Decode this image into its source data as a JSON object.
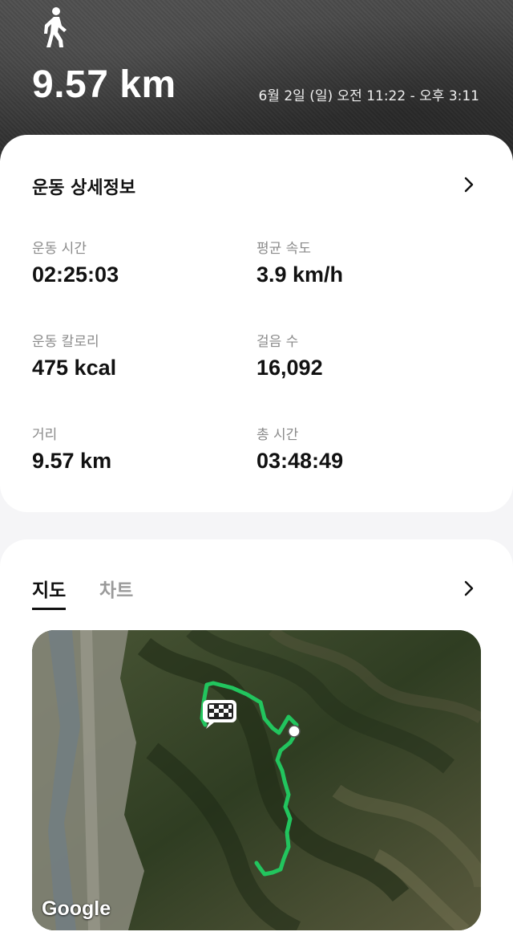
{
  "header": {
    "activity_icon": "walking-person-icon",
    "distance": "9.57 km",
    "date_range": "6월 2일 (일) 오전 11:22 - 오후 3:11"
  },
  "details": {
    "title": "운동 상세정보",
    "chevron_icon": "chevron-right-icon",
    "stats": [
      {
        "label": "운동 시간",
        "value": "02:25:03"
      },
      {
        "label": "평균 속도",
        "value": "3.9 km/h"
      },
      {
        "label": "운동 칼로리",
        "value": "475 kcal"
      },
      {
        "label": "걸음 수",
        "value": "16,092"
      },
      {
        "label": "거리",
        "value": "9.57 km"
      },
      {
        "label": "총 시간",
        "value": "03:48:49"
      }
    ]
  },
  "map_section": {
    "tabs": [
      {
        "label": "지도",
        "active": true
      },
      {
        "label": "차트",
        "active": false
      }
    ],
    "chevron_icon": "chevron-right-icon",
    "provider": "Google",
    "route_color": "#22c55e",
    "start_marker_icon": "checkered-flag-icon",
    "end_marker_icon": "end-point-dot-icon"
  }
}
